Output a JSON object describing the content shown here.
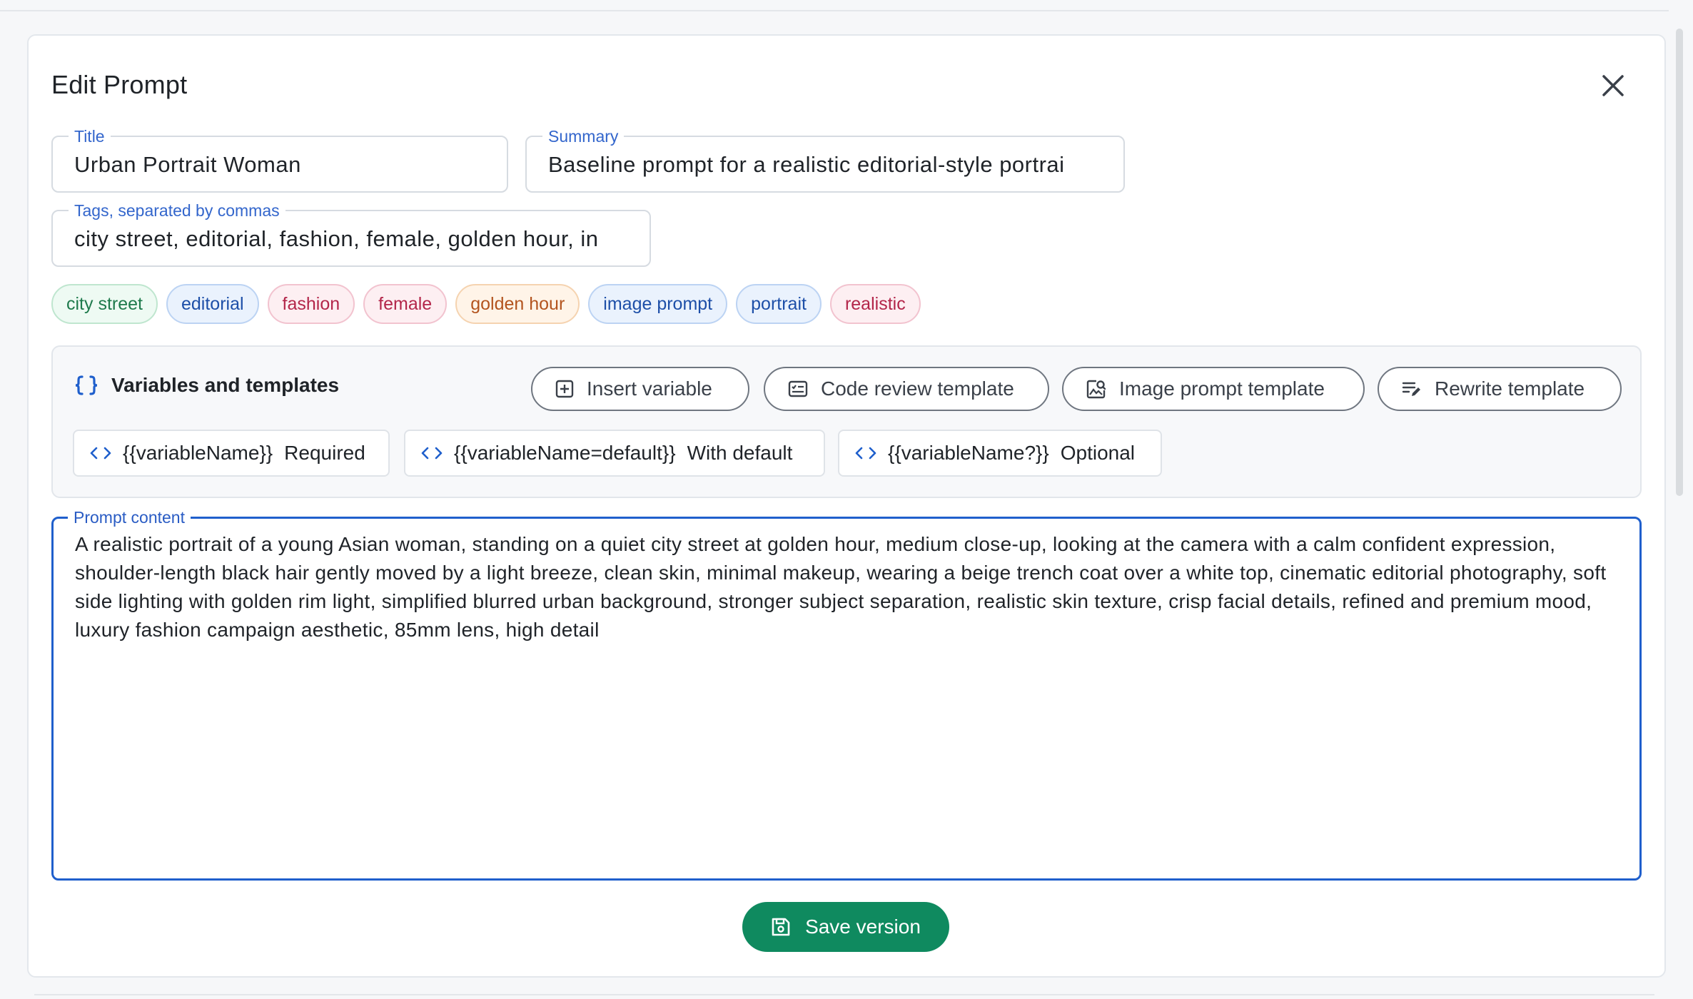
{
  "dialog": {
    "title": "Edit Prompt"
  },
  "fields": {
    "title": {
      "label": "Title",
      "value": "Urban Portrait Woman"
    },
    "summary": {
      "label": "Summary",
      "value": "Baseline prompt for a realistic editorial-style portrai"
    },
    "tags": {
      "label": "Tags, separated by commas",
      "value": "city street, editorial, fashion, female, golden hour, in"
    }
  },
  "tags": [
    {
      "label": "city street",
      "text": "#1e7a4c",
      "bg": "#eefaf3",
      "border": "#bfe6cf"
    },
    {
      "label": "editorial",
      "text": "#1d4fa8",
      "bg": "#eaf2fd",
      "border": "#bcd3f3"
    },
    {
      "label": "fashion",
      "text": "#b3264a",
      "bg": "#fdeff2",
      "border": "#f2c3cf"
    },
    {
      "label": "female",
      "text": "#b3264a",
      "bg": "#fdeff2",
      "border": "#f2c3cf"
    },
    {
      "label": "golden hour",
      "text": "#b3541e",
      "bg": "#fff4e8",
      "border": "#f5d3b0"
    },
    {
      "label": "image prompt",
      "text": "#1d4fa8",
      "bg": "#eaf2fd",
      "border": "#bcd3f3"
    },
    {
      "label": "portrait",
      "text": "#1d4fa8",
      "bg": "#eaf2fd",
      "border": "#bcd3f3"
    },
    {
      "label": "realistic",
      "text": "#b3264a",
      "bg": "#fdeff2",
      "border": "#f2c3cf"
    }
  ],
  "variables": {
    "title": "Variables and templates",
    "title_icon": "braces-icon",
    "buttons": [
      {
        "label": "Insert variable",
        "icon": "plus-square-icon"
      },
      {
        "label": "Code review template",
        "icon": "checklist-icon"
      },
      {
        "label": "Image prompt template",
        "icon": "image-search-icon"
      },
      {
        "label": "Rewrite template",
        "icon": "edit-lines-icon"
      }
    ],
    "chips": [
      {
        "code": "{{variableName}}",
        "desc": "Required",
        "icon": "code-icon"
      },
      {
        "code": "{{variableName=default}}",
        "desc": "With default",
        "icon": "code-icon"
      },
      {
        "code": "{{variableName?}}",
        "desc": "Optional",
        "icon": "code-icon"
      }
    ]
  },
  "content": {
    "label": "Prompt content",
    "value": "A realistic portrait of a young Asian woman, standing on a quiet city street at golden hour, medium close-up, looking at the camera with a calm confident expression, shoulder-length black hair gently moved by a light breeze, clean skin, minimal makeup, wearing a beige trench coat over a white top, cinematic editorial photography, soft side lighting with golden rim light, simplified blurred urban background, stronger subject separation, realistic skin texture, crisp facial details, refined and premium mood, luxury fashion campaign aesthetic, 85mm lens, high detail"
  },
  "actions": {
    "save_label": "Save version",
    "save_icon": "save-icon",
    "save_color": "#0f8a5f"
  },
  "colors": {
    "accent": "#1f5fcc",
    "label_blue": "#3366cc"
  }
}
